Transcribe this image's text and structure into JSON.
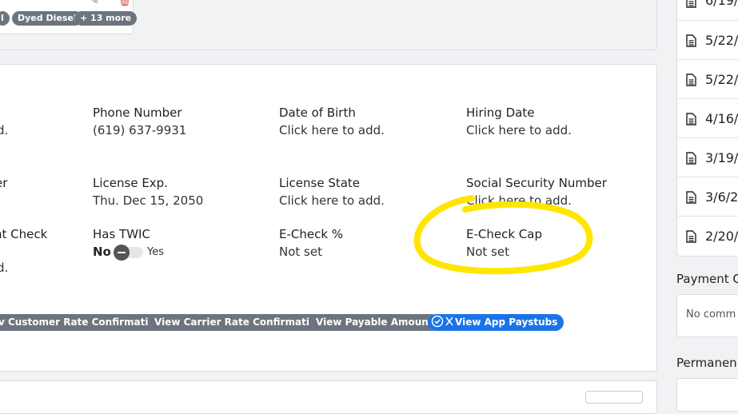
{
  "tags": {
    "items": [
      "l",
      "Dyed Diesel",
      "+ 13 more"
    ],
    "edit_icon": "pencil-icon",
    "delete_icon": "trash-icon"
  },
  "fields": {
    "col0": {
      "row1_value": "d.",
      "row2_label": "er",
      "row3_label": "nt Check",
      "row3_value": "d."
    },
    "phone": {
      "label": "Phone Number",
      "value": "(619) 637-9931"
    },
    "dob": {
      "label": "Date of Birth",
      "value": "Click here to add."
    },
    "hiring": {
      "label": "Hiring Date",
      "value": "Click here to add."
    },
    "license_exp": {
      "label": "License Exp.",
      "value": "Thu. Dec 15, 2050"
    },
    "license_state": {
      "label": "License State",
      "value": "Click here to add."
    },
    "ssn": {
      "label": "Social Security Number",
      "value": "Click here to add."
    },
    "twic": {
      "label": "Has TWIC",
      "no": "No",
      "yes": "Yes",
      "checked": false
    },
    "echeck_pct": {
      "label": "E-Check %",
      "value": "Not set"
    },
    "echeck_cap": {
      "label": "E-Check Cap",
      "value": "Not set"
    }
  },
  "actions": {
    "customer_rate": "v Customer Rate Confirmation",
    "carrier_rate": "View Carrier Rate Confirmation",
    "payable": "View Payable Amount",
    "paystubs": "View App Paystubs"
  },
  "sidebar": {
    "documents": [
      "6/19/",
      "5/22/",
      "5/22/",
      "4/16/",
      "3/19/",
      "3/6/2",
      "2/20/"
    ],
    "payment_title": "Payment C",
    "payment_empty": "No comm",
    "permanent_title": "Permanen"
  },
  "colors": {
    "pill_gray": "#6c757d",
    "primary_blue": "#1a73e8",
    "annotation_yellow": "#ffe600"
  }
}
